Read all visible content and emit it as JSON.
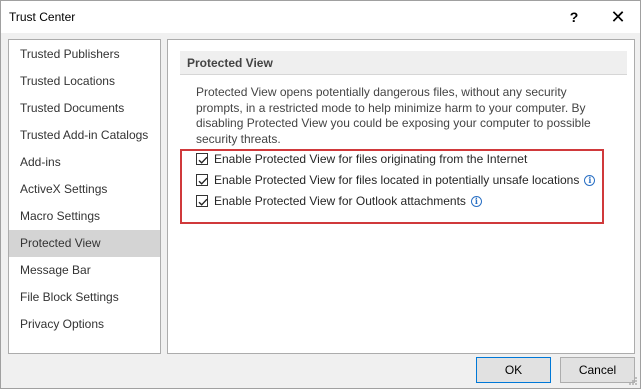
{
  "window": {
    "title": "Trust Center",
    "help_label": "?",
    "close_label": "✕"
  },
  "sidebar": {
    "items": [
      {
        "label": "Trusted Publishers"
      },
      {
        "label": "Trusted Locations"
      },
      {
        "label": "Trusted Documents"
      },
      {
        "label": "Trusted Add-in Catalogs"
      },
      {
        "label": "Add-ins"
      },
      {
        "label": "ActiveX Settings"
      },
      {
        "label": "Macro Settings"
      },
      {
        "label": "Protected View",
        "selected": true
      },
      {
        "label": "Message Bar"
      },
      {
        "label": "File Block Settings"
      },
      {
        "label": "Privacy Options"
      }
    ]
  },
  "main": {
    "section_title": "Protected View",
    "description": "Protected View opens potentially dangerous files, without any security prompts, in a restricted mode to help minimize harm to your computer. By disabling Protected View you could be exposing your computer to possible security threats.",
    "options": [
      {
        "label": "Enable Protected View for files originating from the Internet",
        "checked": true,
        "info": false
      },
      {
        "label": "Enable Protected View for files located in potentially unsafe locations",
        "checked": true,
        "info": true
      },
      {
        "label": "Enable Protected View for Outlook attachments",
        "checked": true,
        "info": true
      }
    ]
  },
  "footer": {
    "ok_label": "OK",
    "cancel_label": "Cancel"
  },
  "colors": {
    "highlight": "#d0393b",
    "selected_bg": "#d4d4d4",
    "info": "#2a70c4"
  }
}
